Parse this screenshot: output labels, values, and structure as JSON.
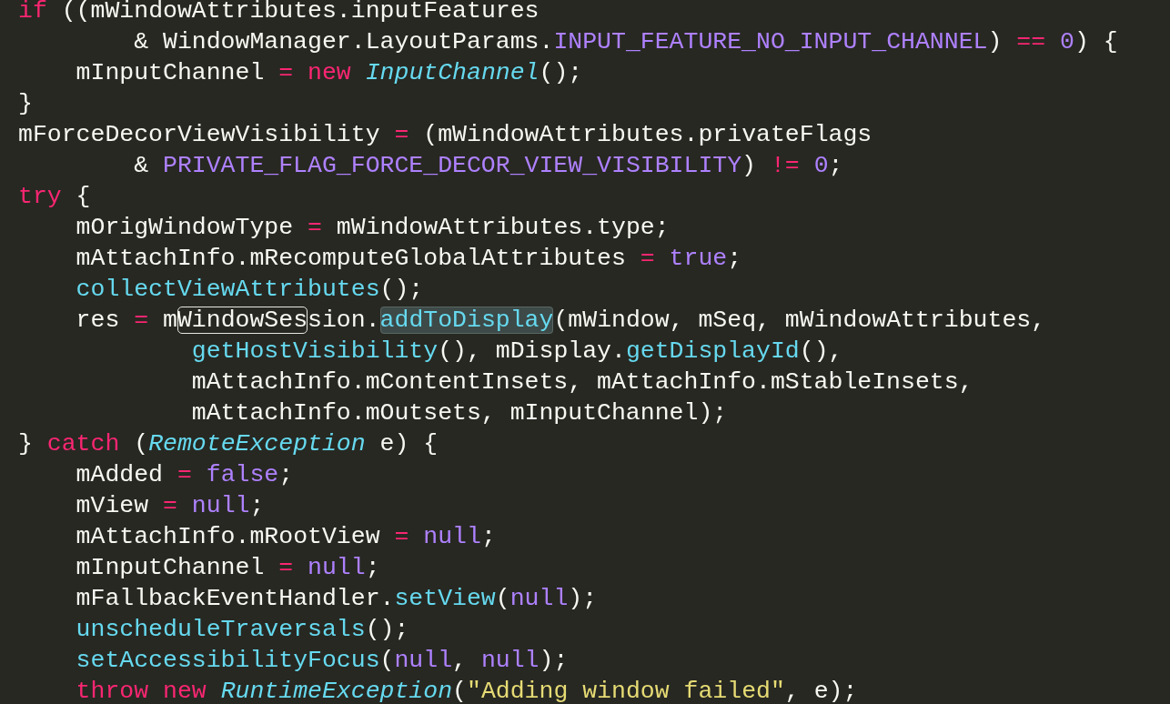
{
  "editor": {
    "lines": [
      {
        "tokens": [
          {
            "text": "if",
            "kind": "keyword"
          },
          {
            "text": " ((mWindowAttributes.inputFeatures",
            "kind": "plain"
          }
        ],
        "children": [
          {
            "continuation": true,
            "tokens": [
              {
                "text": "& WindowManager.LayoutParams.",
                "kind": "plain"
              },
              {
                "text": "INPUT_FEATURE_NO_INPUT_CHANNEL",
                "kind": "constant"
              },
              {
                "text": ") ",
                "kind": "plain"
              },
              {
                "text": "==",
                "kind": "keyword"
              },
              {
                "text": " 0",
                "kind": "constant"
              },
              {
                "text": ") {",
                "kind": "plain"
              }
            ]
          },
          {
            "continuation": false,
            "tokens": [
              {
                "text": "mInputChannel ",
                "kind": "plain"
              },
              {
                "text": "=",
                "kind": "keyword"
              },
              {
                "text": " new",
                "kind": "keyword"
              },
              {
                "text": " InputChannel",
                "kind": "class"
              },
              {
                "text": "();",
                "kind": "plain"
              }
            ]
          }
        ]
      },
      {
        "tokens": [
          {
            "text": "}",
            "kind": "plain"
          }
        ]
      },
      {
        "tokens": [
          {
            "text": "mForceDecorViewVisibility ",
            "kind": "plain"
          },
          {
            "text": "=",
            "kind": "keyword"
          },
          {
            "text": " (mWindowAttributes.privateFlags",
            "kind": "plain"
          }
        ],
        "children": [
          {
            "continuation": true,
            "tokens": [
              {
                "text": "& ",
                "kind": "plain"
              },
              {
                "text": "PRIVATE_FLAG_FORCE_DECOR_VIEW_VISIBILITY",
                "kind": "constant"
              },
              {
                "text": ") ",
                "kind": "plain"
              },
              {
                "text": "!=",
                "kind": "keyword"
              },
              {
                "text": " 0",
                "kind": "constant"
              },
              {
                "text": ";",
                "kind": "plain"
              }
            ]
          }
        ]
      },
      {
        "tokens": [
          {
            "text": "try",
            "kind": "keyword"
          },
          {
            "text": " {",
            "kind": "plain"
          }
        ],
        "children": [
          {
            "continuation": false,
            "tokens": [
              {
                "text": "mOrigWindowType ",
                "kind": "plain"
              },
              {
                "text": "=",
                "kind": "keyword"
              },
              {
                "text": " mWindowAttributes.type;",
                "kind": "plain"
              }
            ]
          },
          {
            "continuation": false,
            "tokens": [
              {
                "text": "mAttachInfo.mRecomputeGlobalAttributes ",
                "kind": "plain"
              },
              {
                "text": "=",
                "kind": "keyword"
              },
              {
                "text": " true",
                "kind": "constant"
              },
              {
                "text": ";",
                "kind": "plain"
              }
            ]
          },
          {
            "continuation": false,
            "tokens": [
              {
                "text": "collectViewAttributes",
                "kind": "function"
              },
              {
                "text": "();",
                "kind": "plain"
              }
            ]
          },
          {
            "continuation": false,
            "tokens": [
              {
                "text": "res ",
                "kind": "plain",
                "boxed": false,
                "selected": false
              },
              {
                "text": "=",
                "kind": "keyword",
                "boxed": false,
                "selected": false
              },
              {
                "text": " m",
                "kind": "plain",
                "boxed": false,
                "selected": false
              },
              {
                "text": "WindowSes",
                "kind": "plain",
                "boxed": true,
                "selected": false
              },
              {
                "text": "sion.",
                "kind": "plain",
                "boxed": false,
                "selected": false
              },
              {
                "text": "addToDisplay",
                "kind": "function",
                "boxed": false,
                "selected": true
              },
              {
                "text": "(mWindow, mSeq, mWindowAttributes,",
                "kind": "plain",
                "boxed": false,
                "selected": false
              }
            ],
            "children": [
              {
                "continuation": true,
                "tokens": [
                  {
                    "text": "getHostVisibility",
                    "kind": "function"
                  },
                  {
                    "text": "(), mDisplay.",
                    "kind": "plain"
                  },
                  {
                    "text": "getDisplayId",
                    "kind": "function"
                  },
                  {
                    "text": "(),",
                    "kind": "plain"
                  }
                ]
              },
              {
                "continuation": true,
                "tokens": [
                  {
                    "text": "mAttachInfo.mContentInsets, mAttachInfo.mStableInsets,",
                    "kind": "plain"
                  }
                ]
              },
              {
                "continuation": true,
                "tokens": [
                  {
                    "text": "mAttachInfo.mOutsets, mInputChannel);",
                    "kind": "plain"
                  }
                ]
              }
            ]
          }
        ]
      },
      {
        "tokens": [
          {
            "text": "} ",
            "kind": "plain"
          },
          {
            "text": "catch",
            "kind": "keyword"
          },
          {
            "text": " (",
            "kind": "plain"
          },
          {
            "text": "RemoteException",
            "kind": "class"
          },
          {
            "text": " e) {",
            "kind": "plain"
          }
        ],
        "children": [
          {
            "continuation": false,
            "tokens": [
              {
                "text": "mAdded ",
                "kind": "plain"
              },
              {
                "text": "=",
                "kind": "keyword"
              },
              {
                "text": " false",
                "kind": "constant"
              },
              {
                "text": ";",
                "kind": "plain"
              }
            ]
          },
          {
            "continuation": false,
            "tokens": [
              {
                "text": "mView ",
                "kind": "plain"
              },
              {
                "text": "=",
                "kind": "keyword"
              },
              {
                "text": " null",
                "kind": "constant"
              },
              {
                "text": ";",
                "kind": "plain"
              }
            ]
          },
          {
            "continuation": false,
            "tokens": [
              {
                "text": "mAttachInfo.mRootView ",
                "kind": "plain"
              },
              {
                "text": "=",
                "kind": "keyword"
              },
              {
                "text": " null",
                "kind": "constant"
              },
              {
                "text": ";",
                "kind": "plain"
              }
            ]
          },
          {
            "continuation": false,
            "tokens": [
              {
                "text": "mInputChannel ",
                "kind": "plain"
              },
              {
                "text": "=",
                "kind": "keyword"
              },
              {
                "text": " null",
                "kind": "constant"
              },
              {
                "text": ";",
                "kind": "plain"
              }
            ]
          },
          {
            "continuation": false,
            "tokens": [
              {
                "text": "mFallbackEventHandler.",
                "kind": "plain"
              },
              {
                "text": "setView",
                "kind": "function"
              },
              {
                "text": "(",
                "kind": "plain"
              },
              {
                "text": "null",
                "kind": "constant"
              },
              {
                "text": ");",
                "kind": "plain"
              }
            ]
          },
          {
            "continuation": false,
            "tokens": [
              {
                "text": "unscheduleTraversals",
                "kind": "function"
              },
              {
                "text": "();",
                "kind": "plain"
              }
            ]
          },
          {
            "continuation": false,
            "tokens": [
              {
                "text": "setAccessibilityFocus",
                "kind": "function"
              },
              {
                "text": "(",
                "kind": "plain"
              },
              {
                "text": "null",
                "kind": "constant"
              },
              {
                "text": ", ",
                "kind": "plain"
              },
              {
                "text": "null",
                "kind": "constant"
              },
              {
                "text": ");",
                "kind": "plain"
              }
            ]
          },
          {
            "continuation": false,
            "tokens": [
              {
                "text": "throw",
                "kind": "keyword"
              },
              {
                "text": " new",
                "kind": "keyword"
              },
              {
                "text": " RuntimeException",
                "kind": "class"
              },
              {
                "text": "(",
                "kind": "plain"
              },
              {
                "text": "\"Adding window failed\"",
                "kind": "string"
              },
              {
                "text": ", e);",
                "kind": "plain"
              }
            ]
          }
        ]
      }
    ]
  }
}
